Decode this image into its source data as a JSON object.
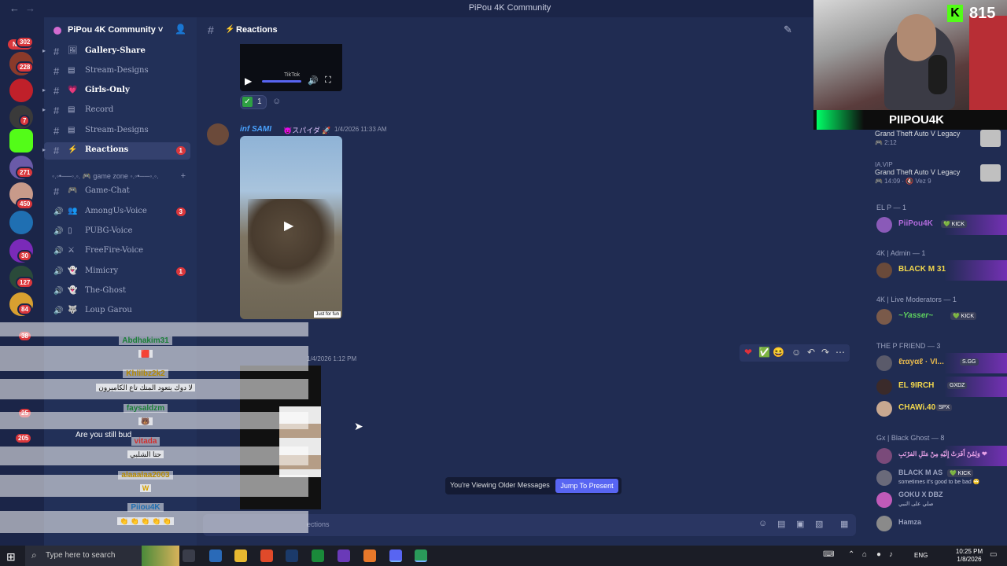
{
  "window": {
    "title": "PiPou 4K Community",
    "back": "←",
    "forward": "→"
  },
  "servers": {
    "new_label": "NEW",
    "badges": [
      "302",
      "228",
      "7",
      "271",
      "450",
      "30",
      "127",
      "84",
      "38",
      "25",
      "205"
    ]
  },
  "guild": {
    "name": "PiPou 4K Community ˅"
  },
  "channels": [
    {
      "name": "Gallery-Share",
      "emoji": "🖼",
      "bold": true,
      "badge": ""
    },
    {
      "name": "Stream-Designs",
      "emoji": "▤",
      "bold": false,
      "badge": ""
    },
    {
      "name": "Girls-Only",
      "emoji": "💗",
      "bold": true,
      "badge": ""
    },
    {
      "name": "Record",
      "emoji": "▤",
      "bold": false,
      "badge": ""
    },
    {
      "name": "Stream-Designs",
      "emoji": "▤",
      "bold": false,
      "badge": ""
    },
    {
      "name": "Reactions",
      "emoji": "⚡",
      "bold": true,
      "badge": "1"
    }
  ],
  "category": {
    "name": "◦.◦•──◦.◦. 🎮 game zone ◦.◦•──◦.◦.",
    "plus": "+"
  },
  "channels2": [
    {
      "name": "Game-Chat",
      "emoji": "🎮",
      "type": "#",
      "badge": ""
    },
    {
      "name": "AmongUs-Voice",
      "emoji": "👥",
      "type": "🔊",
      "badge": "3"
    },
    {
      "name": "PUBG-Voice",
      "emoji": "▯",
      "type": "🔊",
      "badge": ""
    },
    {
      "name": "FreeFire-Voice",
      "emoji": "⚔",
      "type": "🔊",
      "badge": ""
    },
    {
      "name": "Mimicry",
      "emoji": "👻",
      "type": "🔊",
      "badge": "1"
    },
    {
      "name": "The-Ghost",
      "emoji": "👻",
      "type": "🔊",
      "badge": ""
    },
    {
      "name": "Loup Garou",
      "emoji": "🐺",
      "type": "🔊",
      "badge": ""
    }
  ],
  "header": {
    "channel": "Reactions",
    "emoji": "⚡"
  },
  "messages": {
    "reaction_count": "1",
    "author": "inf SAMI",
    "author_tag": "😈スパイダ 🚀",
    "timestamp": "1/4/2026 11:33 AM",
    "video_label": "TikTok",
    "watermark": "Just for fun",
    "timestamp2": "1/4/2026 1:12 PM"
  },
  "older_bar": {
    "text": "You're Viewing Older Messages",
    "button": "Jump To Present"
  },
  "composer": {
    "placeholder": "ections"
  },
  "kick": {
    "logo": "K",
    "count": "815"
  },
  "stream": {
    "logo": "PIIPOU4K"
  },
  "members": {
    "games": [
      {
        "title": "Grand Theft Auto V Legacy",
        "sub": "🎮 2:12"
      },
      {
        "user": "IA.VIP",
        "title": "Grand Theft Auto V Legacy",
        "sub": "🎮 14:09 · 🔇 Vez 9"
      }
    ],
    "groups": [
      {
        "label": "EL P — 1",
        "members": [
          {
            "name": "PiiPou4K",
            "tag": "💚 KICK",
            "color": "#b06adb"
          }
        ]
      },
      {
        "label": "4K | Admin — 1",
        "members": [
          {
            "name": "BLACK M 31",
            "tag": "",
            "color": "#f2d74d"
          }
        ]
      },
      {
        "label": "4K | Live Moderators — 1",
        "members": [
          {
            "name": "~Yasser~",
            "tag": "💚 KICK",
            "color": "#5fd35f"
          }
        ]
      },
      {
        "label": "THE P FRIEND — 3",
        "members": [
          {
            "name": "ℓ𝔯αуαℓ · VI...",
            "tag": "S.GG",
            "color": "#e6b84d"
          },
          {
            "name": "EL 9IRCH",
            "tag": "GXDZ",
            "color": "#f2d74d"
          },
          {
            "name": "CHAWi.40",
            "tag": "SPX",
            "color": "#f2d74d"
          }
        ]
      },
      {
        "label": "Gx | Black Ghost — 8",
        "members": [
          {
            "name": "وَلِمُنْ أَفَرَتْ إِلَيْهِ مِنْ مَثَلِ الفرْنَبِ ❤",
            "tag": "",
            "color": "#e6a0e6"
          },
          {
            "name": "BLACK M AS",
            "tag": "💚 KICK",
            "color": "#9aa2bf",
            "status": "sometimes it's good to be bad 🙄"
          },
          {
            "name": "GOKU X DBZ",
            "tag": "",
            "color": "#9aa2bf",
            "status": "صلي على النبي"
          },
          {
            "name": "Hamza",
            "tag": "",
            "color": "#9aa2bf"
          }
        ]
      }
    ]
  },
  "overlay": {
    "entries": [
      {
        "user": "Abdhakim31",
        "color": "#1a7f37",
        "msg": "🟥"
      },
      {
        "user": "Khlilbz2k2",
        "color": "#b58900",
        "msg": "لا دوك يتعود المتك تاع الكاميرون"
      },
      {
        "user": "faysaldzm",
        "color": "#1a7f37",
        "msg": "🐻"
      },
      {
        "user": "vitada",
        "color": "#d12f2f",
        "msg": "حتا الشلبي"
      },
      {
        "user": "alaaalaa2003",
        "color": "#b58900",
        "msg": "W"
      },
      {
        "user": "Piiou4K",
        "color": "#1f6fb2",
        "msg": "👏 👏 👏 👏 👏"
      }
    ],
    "sidetext": "Are you still bud"
  },
  "taskbar": {
    "search": "Type here to search",
    "eng": "ENG",
    "time": "10:25 PM",
    "date": "1/8/2026"
  }
}
